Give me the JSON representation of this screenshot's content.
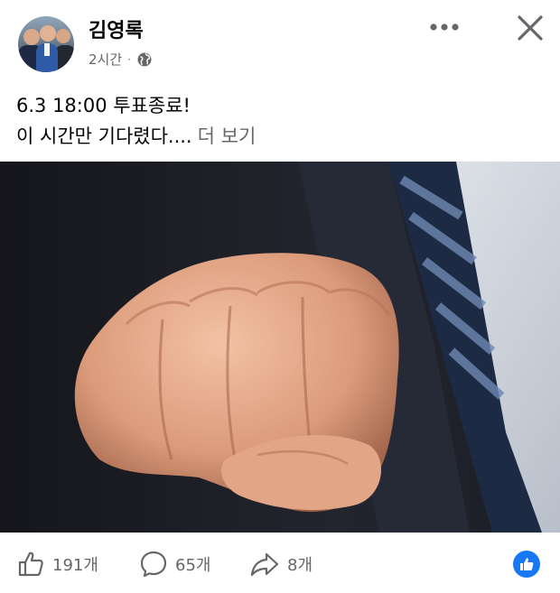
{
  "post": {
    "author": "김영록",
    "time": "2시간",
    "separator": "·",
    "privacy_icon": "globe-icon",
    "text_line1": "6.3 18:00  투표종료!",
    "text_line2": "이 시간만 기다렸다....",
    "see_more": "더 보기"
  },
  "header_icons": {
    "more": "more-dots-icon",
    "close": "close-icon"
  },
  "actions": {
    "like_count": "191개",
    "comment_count": "65개",
    "share_count": "8개",
    "reaction_icon": "like-reaction-icon"
  },
  "colors": {
    "text": "#050505",
    "secondary": "#65676b",
    "facebook_blue": "#1877f2"
  }
}
